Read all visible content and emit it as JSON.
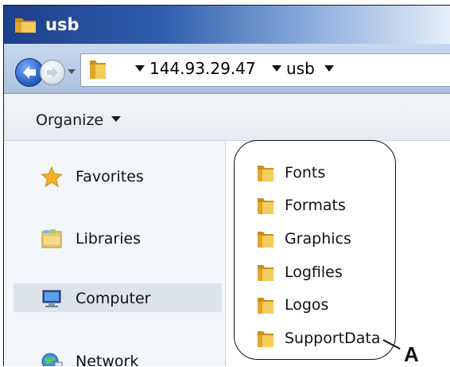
{
  "window": {
    "title": "usb",
    "title_icon": "folder-icon"
  },
  "address_bar": {
    "back_icon": "back-arrow-icon",
    "forward_icon": "forward-arrow-icon",
    "path": [
      "144.93.29.47",
      "usb"
    ]
  },
  "toolbar": {
    "organize_label": "Organize"
  },
  "nav_pane": {
    "items": [
      {
        "label": "Favorites",
        "icon": "star-icon"
      },
      {
        "label": "Libraries",
        "icon": "libraries-icon"
      },
      {
        "label": "Computer",
        "icon": "computer-icon",
        "selected": true
      },
      {
        "label": "Network",
        "icon": "network-icon"
      }
    ]
  },
  "content": {
    "folders": [
      "Fonts",
      "Formats",
      "Graphics",
      "Logfiles",
      "Logos",
      "SupportData"
    ]
  },
  "annotation": {
    "label": "A"
  },
  "colors": {
    "titlebar_start": "#1f3f8a",
    "folder_yellow": "#e8b93a",
    "selection": "#dde3ea"
  }
}
